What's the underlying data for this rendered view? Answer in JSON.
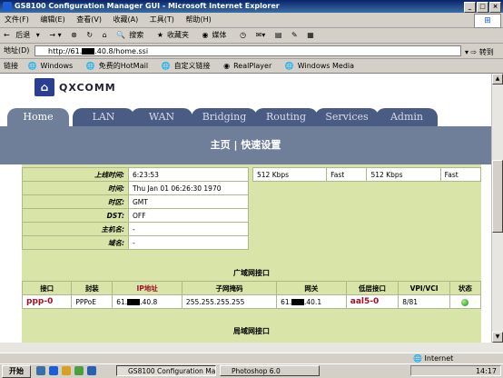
{
  "window": {
    "title": "GS8100 Configuration Manager GUI - Microsoft Internet Explorer",
    "controls": [
      "_",
      "□",
      "×"
    ]
  },
  "menubar": [
    "文件(F)",
    "编辑(E)",
    "查看(V)",
    "收藏(A)",
    "工具(T)",
    "帮助(H)"
  ],
  "toolbar": {
    "back": "后退",
    "search": "搜索",
    "favorites": "收藏夹",
    "media": "媒体"
  },
  "address": {
    "label": "地址(D)",
    "url_start": "http://61.",
    "url_end": ".40.8/home.ssi",
    "go": "转到"
  },
  "links": {
    "label": "链接",
    "items": [
      "Windows",
      "免费的HotMail",
      "自定义链接",
      "RealPlayer",
      "Windows Media"
    ]
  },
  "page": {
    "logo_text": "QXCOMM",
    "tabs": [
      "Home",
      "LAN",
      "WAN",
      "Bridging",
      "Routing",
      "Services",
      "Admin"
    ],
    "active_tab": "Home",
    "subnav": "主页 | 快速设置",
    "status_rows": [
      {
        "label": "上线时间:",
        "value": "6:23:53"
      },
      {
        "label": "时间:",
        "value": "Thu Jan 01 06:26:30 1970"
      },
      {
        "label": "时区:",
        "value": "GMT"
      },
      {
        "label": "DST:",
        "value": "OFF"
      },
      {
        "label": "主机名:",
        "value": "-"
      },
      {
        "label": "域名:",
        "value": "-"
      }
    ],
    "port_stats": [
      "512 Kbps",
      "Fast",
      "512 Kbps",
      "Fast"
    ],
    "wan_title": "广域网接口",
    "wan_headers": [
      "接口",
      "封装",
      "IP地址",
      "子网掩码",
      "网关",
      "低层接口",
      "VPI/VCI",
      "状态"
    ],
    "wan_row": {
      "interface": "ppp-0",
      "encap": "PPPoE",
      "ip_start": "61.",
      "ip_end": ".40.8",
      "netmask": "255.255.255.255",
      "gateway_start": "61.",
      "gateway_end": ".40.1",
      "lower": "aal5-0",
      "vpivci": "8/81"
    },
    "lan_title": "局域网接口"
  },
  "statusbar": {
    "zone": "Internet"
  },
  "taskbar": {
    "start": "开始",
    "tasks": [
      "GS8100 Configuration Ma...",
      "Photoshop 6.0"
    ],
    "clock": "14:17"
  }
}
